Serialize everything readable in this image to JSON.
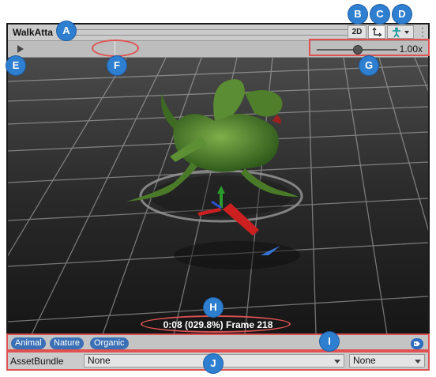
{
  "window": {
    "title": "WalkAtta"
  },
  "toolbar": {
    "btn_2d": "2D",
    "speed_value": "1.00x",
    "speed_level": 0.5
  },
  "viewport": {
    "timecode": "0:08 (029.8%) Frame 218"
  },
  "labels": {
    "items": [
      "Animal",
      "Nature",
      "Organic"
    ]
  },
  "asset_bundle": {
    "label": "AssetBundle",
    "name_value": "None",
    "variant_value": "None"
  },
  "callouts": [
    "A",
    "B",
    "C",
    "D",
    "E",
    "F",
    "G",
    "H",
    "I",
    "J"
  ],
  "colors": {
    "accent": "#2f7fd0",
    "highlight": "#e05252",
    "label_pill": "#3b70b6",
    "axis_red": "#cc1f1f",
    "creature": "#4f7f2a"
  }
}
